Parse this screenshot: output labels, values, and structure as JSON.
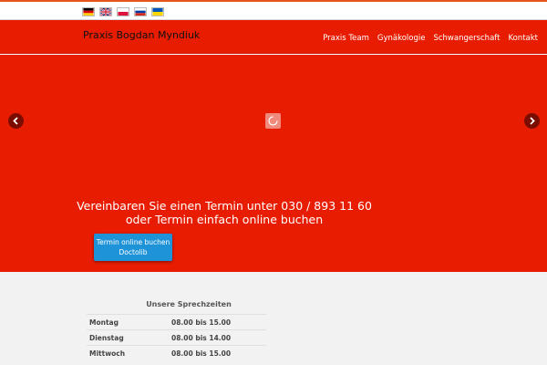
{
  "languages": [
    {
      "name": "Deutsch"
    },
    {
      "name": "English"
    },
    {
      "name": "Polski"
    },
    {
      "name": "Русский"
    },
    {
      "name": "Українська"
    }
  ],
  "header": {
    "brand": "Praxis Bogdan Myndiuk",
    "nav": [
      "Praxis Team",
      "Gynäkologie",
      "Schwangerschaft",
      "Kontakt"
    ]
  },
  "hero": {
    "headline_line1": "Vereinbaren Sie einen Termin unter 030 / 893 11 60",
    "headline_line2": "oder Termin einfach online buchen",
    "cta_line1": "Termin online buchen",
    "cta_line2": "Doctolib",
    "prev_icon": "chevron-left-icon",
    "next_icon": "chevron-right-icon",
    "loader_icon": "spinner-icon"
  },
  "hours": {
    "title": "Unsere Sprechzeiten",
    "rows": [
      {
        "day": "Montag",
        "time": "08.00 bis 15.00"
      },
      {
        "day": "Dienstag",
        "time": "08.00 bis 14.00"
      },
      {
        "day": "Mittwoch",
        "time": "08.00 bis 15.00"
      }
    ]
  },
  "colors": {
    "brand_red": "#e81c00",
    "cta_blue": "#1e93d8",
    "top_accent": "#e5531f"
  }
}
